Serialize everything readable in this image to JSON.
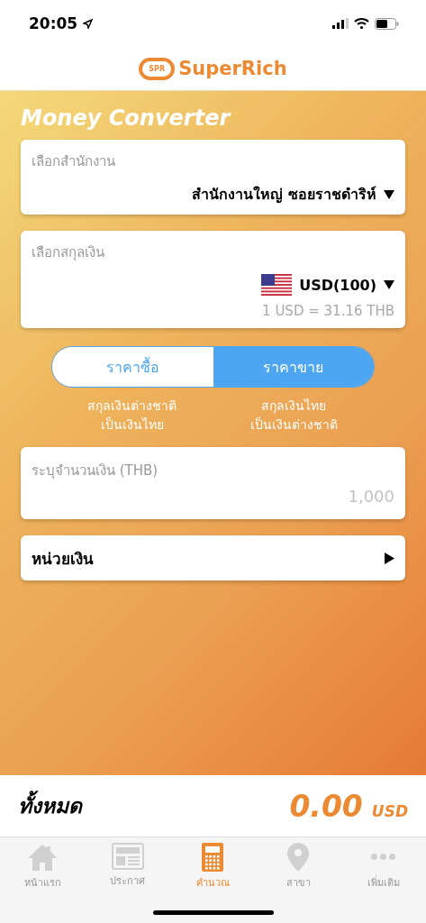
{
  "status_bar": {
    "time": "20:05"
  },
  "header": {
    "logo_mark": "SPR",
    "logo_text": "SuperRich"
  },
  "title": "Money Converter",
  "branch_select": {
    "label": "เลือกสำนักงาน",
    "value": "สำนักงานใหญ่ ซอยราชดำริห์"
  },
  "currency_select": {
    "label": "เลือกสกุลเงิน",
    "value": "USD(100)",
    "rate": "1 USD = 31.16 THB"
  },
  "rate_toggle": [
    {
      "label": "ราคาซื้อ",
      "caption": "สกุลเงินต่างชาติ\nเป็นเงินไทย",
      "selected": false
    },
    {
      "label": "ราคาขาย",
      "caption": "สกุลเงินไทย\nเป็นเงินต่างชาติ",
      "selected": true
    }
  ],
  "amount_field": {
    "label": "ระบุจำนวนเงิน (THB)",
    "placeholder": "1,000"
  },
  "denomination_row": {
    "label": "หน่วยเงิน"
  },
  "total": {
    "label": "ทั้งหมด",
    "value": "0.00",
    "currency": "USD"
  },
  "tab_bar": [
    {
      "kind": "home",
      "label": "หน้าแรก",
      "selected": false
    },
    {
      "kind": "news",
      "label": "ประกาศ",
      "selected": false
    },
    {
      "kind": "calculator",
      "label": "คำนวณ",
      "selected": true
    },
    {
      "kind": "pin",
      "label": "สาขา",
      "selected": false
    },
    {
      "kind": "more",
      "label": "เพิ่มเติม",
      "selected": false
    }
  ]
}
